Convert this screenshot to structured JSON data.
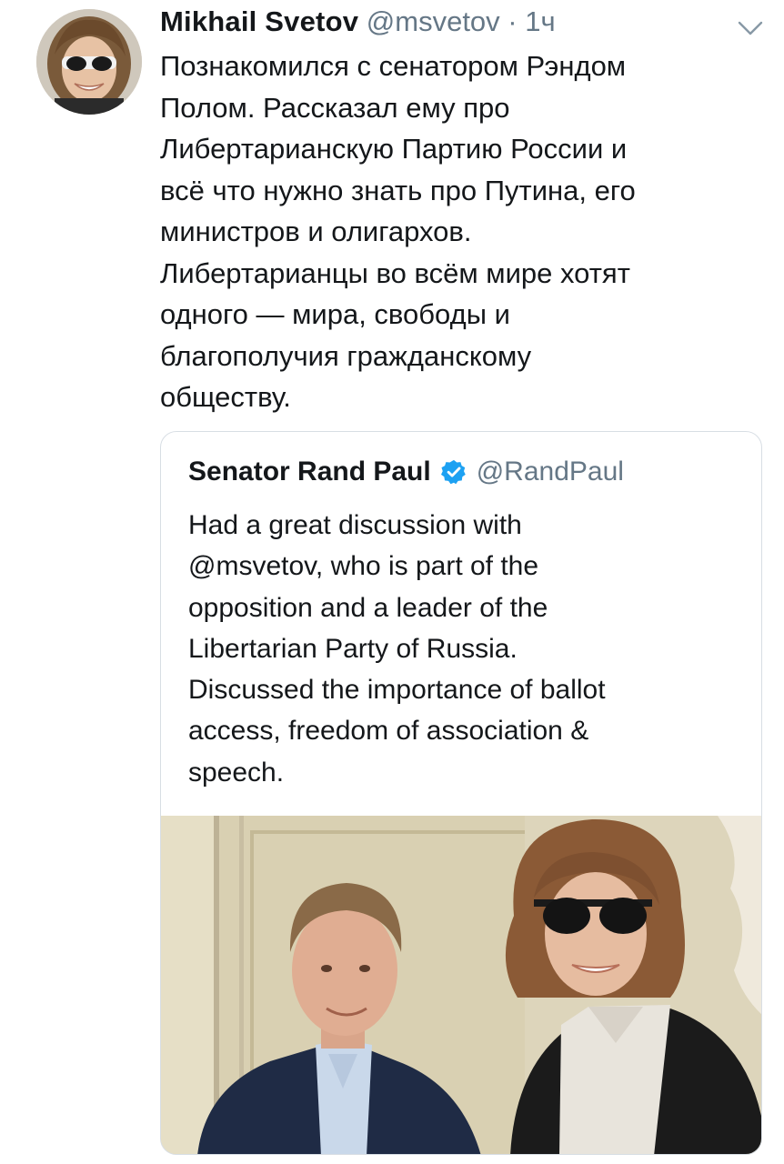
{
  "tweet": {
    "author_name": "Mikhail Svetov",
    "author_handle": "@msvetov",
    "separator": "·",
    "time": "1ч",
    "text": "Познакомился с сенатором Рэндом\nПолом. Рассказал ему про\nЛибертарианскую Партию России и\nвсё что нужно знать про Путина, его\nминистров и олигархов.\nЛибертарианцы во всём мире хотят\nодного — мира, свободы и\nблагополучия гражданскому\nобществу.",
    "menu_icon": "chevron-down-icon"
  },
  "quoted_tweet": {
    "author_name": "Senator Rand Paul",
    "author_handle": "@RandPaul",
    "verified_icon": "verified-badge-icon",
    "text": "Had a great discussion with\n@msvetov, who is part of the\nopposition and a leader of the\nLibertarian Party of Russia.\nDiscussed the importance of ballot\naccess, freedom of association &\nspeech."
  },
  "colors": {
    "text": "#14171a",
    "secondary": "#657786",
    "verified": "#1da1f2",
    "border": "#d8dee4"
  }
}
